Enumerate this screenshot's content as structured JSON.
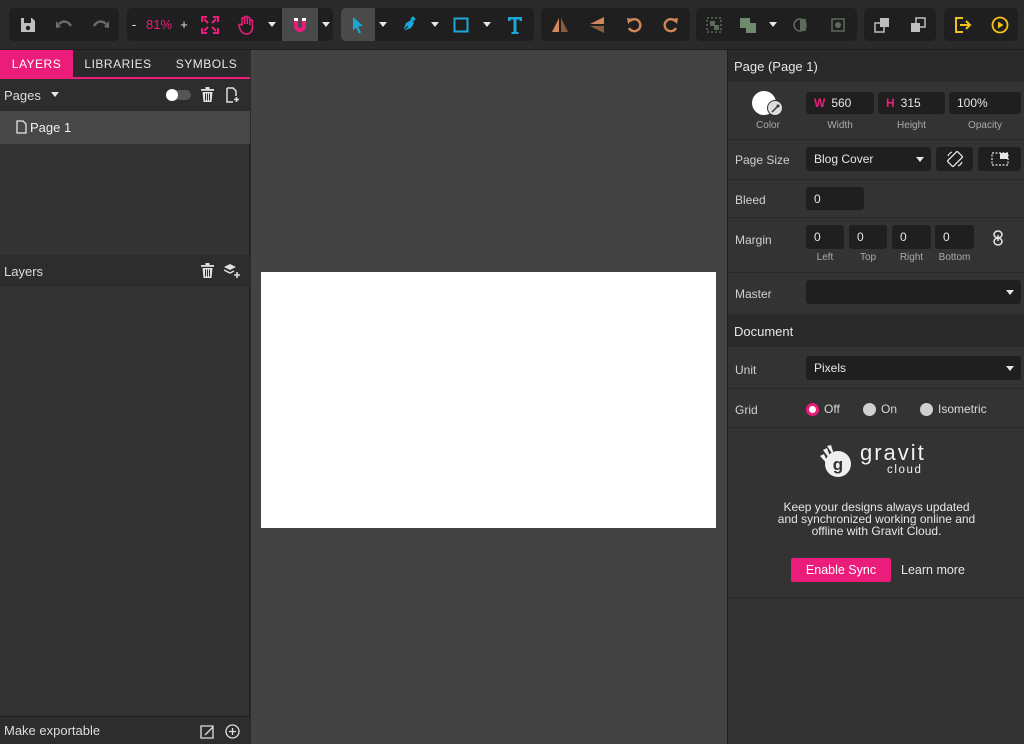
{
  "toolbar": {
    "zoom": {
      "minus": "-",
      "value": "81%",
      "plus": "+"
    }
  },
  "left_panel": {
    "tabs": [
      {
        "label": "LAYERS",
        "active": true
      },
      {
        "label": "LIBRARIES",
        "active": false
      },
      {
        "label": "SYMBOLS",
        "active": false
      }
    ],
    "pages": {
      "title": "Pages",
      "items": [
        "Page 1"
      ]
    },
    "layers": {
      "title": "Layers"
    },
    "footer": {
      "label": "Make exportable"
    }
  },
  "right_panel": {
    "header": "Page (Page 1)",
    "color_label": "Color",
    "width": {
      "prefix": "W",
      "value": "560",
      "label": "Width"
    },
    "height": {
      "prefix": "H",
      "value": "315",
      "label": "Height"
    },
    "opacity": {
      "value": "100%",
      "label": "Opacity"
    },
    "page_size": {
      "label": "Page Size",
      "value": "Blog Cover"
    },
    "bleed": {
      "label": "Bleed",
      "value": "0"
    },
    "margin": {
      "label": "Margin",
      "fields": [
        {
          "value": "0",
          "label": "Left"
        },
        {
          "value": "0",
          "label": "Top"
        },
        {
          "value": "0",
          "label": "Right"
        },
        {
          "value": "0",
          "label": "Bottom"
        }
      ]
    },
    "master": {
      "label": "Master",
      "value": ""
    },
    "document": {
      "title": "Document",
      "unit": {
        "label": "Unit",
        "value": "Pixels"
      },
      "grid": {
        "label": "Grid",
        "options": [
          "Off",
          "On",
          "Isometric"
        ],
        "selected": "Off"
      }
    },
    "cloud": {
      "brand": "gravit",
      "brand_sub": "cloud",
      "text_lines": [
        "Keep your designs always updated",
        "and synchronized working online and",
        "offline with Gravit Cloud."
      ],
      "enable_label": "Enable Sync",
      "learn_label": "Learn more"
    }
  },
  "colors": {
    "accent": "#ec1d7a",
    "tool_blue": "#1ca8d6",
    "tool_orange": "#d2875a"
  }
}
